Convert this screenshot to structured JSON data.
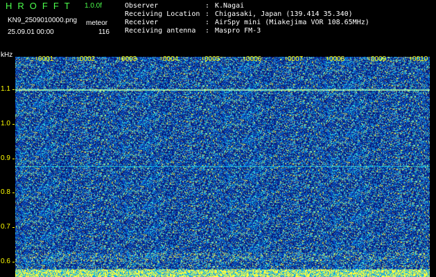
{
  "header": {
    "logo": "HROFFT",
    "version": "1.0.0f",
    "filename": "KN9_2509010000.png",
    "mode": "meteor",
    "datetime": "25.09.01 00:00",
    "count": "116"
  },
  "meta": [
    {
      "key": "Observer",
      "value": "K.Nagai"
    },
    {
      "key": "Receiving Location",
      "value": "Chigasaki, Japan (139.414 35.340)"
    },
    {
      "key": "Receiver",
      "value": "AirSpy mini (Miakejima VOR 108.65MHz)"
    },
    {
      "key": "Receiving antenna",
      "value": "Maspro FM-3"
    }
  ],
  "axis": {
    "unit": "kHz",
    "y_labels": [
      "1.1",
      "1.0",
      "0.9",
      "0.8",
      "0.7",
      "0.6"
    ],
    "minute_labels": [
      "0001",
      "0002",
      "0003",
      "0004",
      "0005",
      "0006",
      "0007",
      "0008",
      "0009",
      "0010"
    ]
  },
  "colors": {
    "background": "#0a1880",
    "accent": "#ffff00",
    "logo": "#4cff4c"
  }
}
